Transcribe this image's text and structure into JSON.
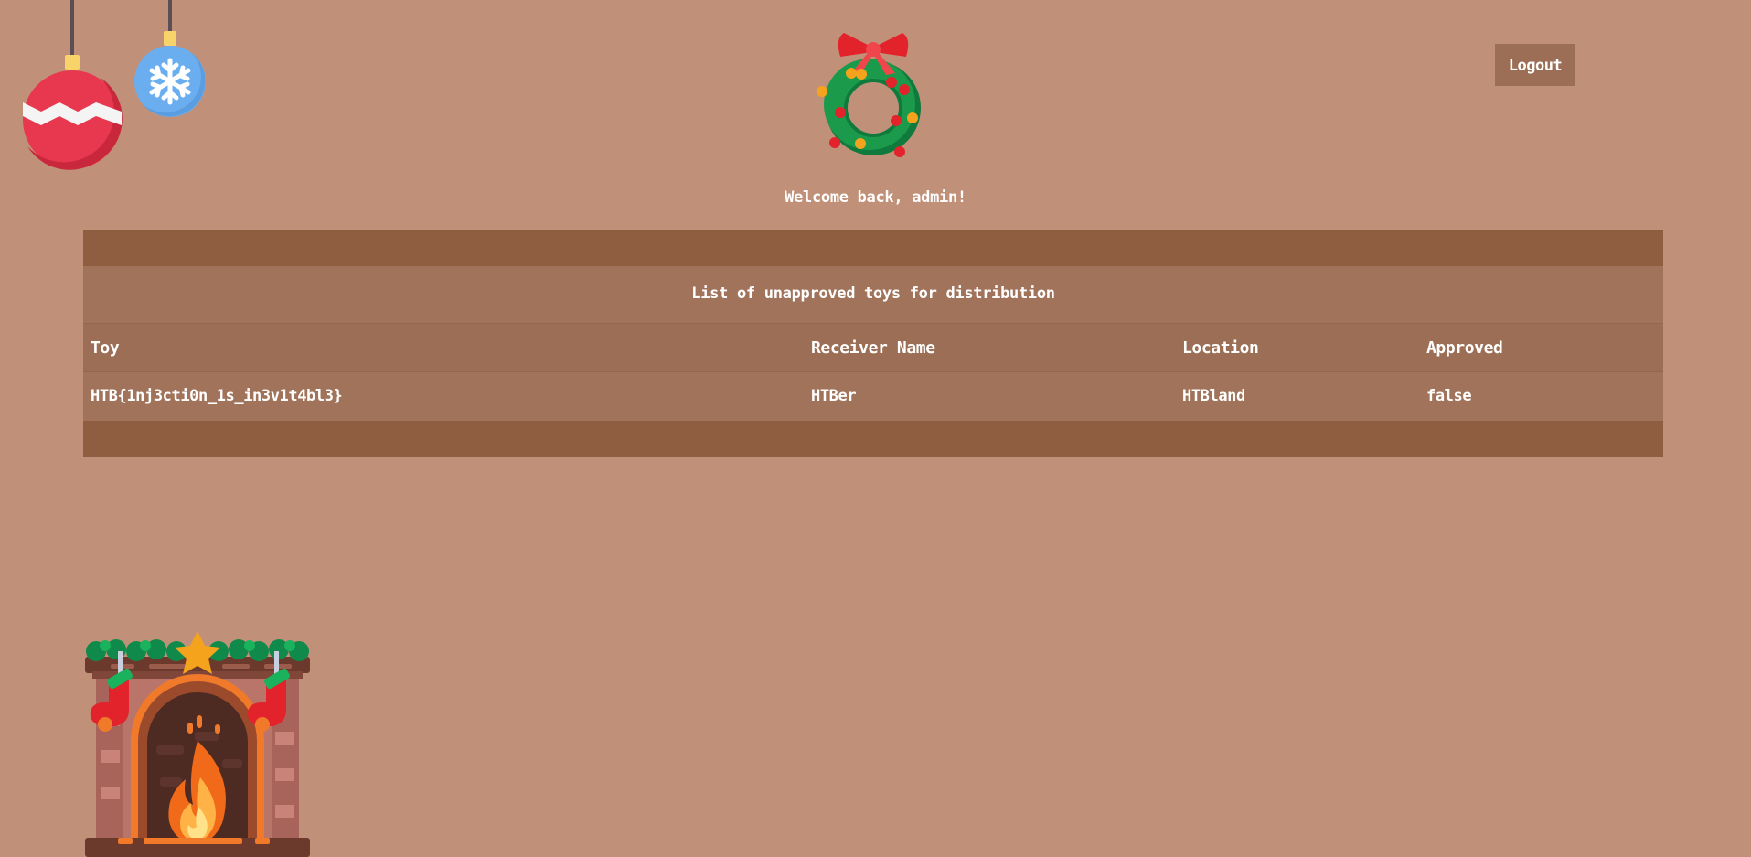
{
  "header": {
    "logout_label": "Logout",
    "welcome_text": "Welcome back, admin!"
  },
  "toys_table": {
    "caption": "List of unapproved toys for distribution",
    "columns": [
      "Toy",
      "Receiver Name",
      "Location",
      "Approved"
    ],
    "rows": [
      {
        "toy": "HTB{1nj3cti0n_1s_in3v1t4bl3}",
        "receiver": "HTBer",
        "location": "HTBland",
        "approved": "false"
      }
    ]
  },
  "decorations": {
    "ornament_left": "christmas-bauble-icon",
    "ornament_right": "snowflake-bauble-icon",
    "wreath": "christmas-wreath-icon",
    "fireplace": "fireplace-icon"
  },
  "colors": {
    "background": "#c09178",
    "table_band": "#8f5e40",
    "table_row": "#a0735a",
    "button": "#9b6e55"
  }
}
